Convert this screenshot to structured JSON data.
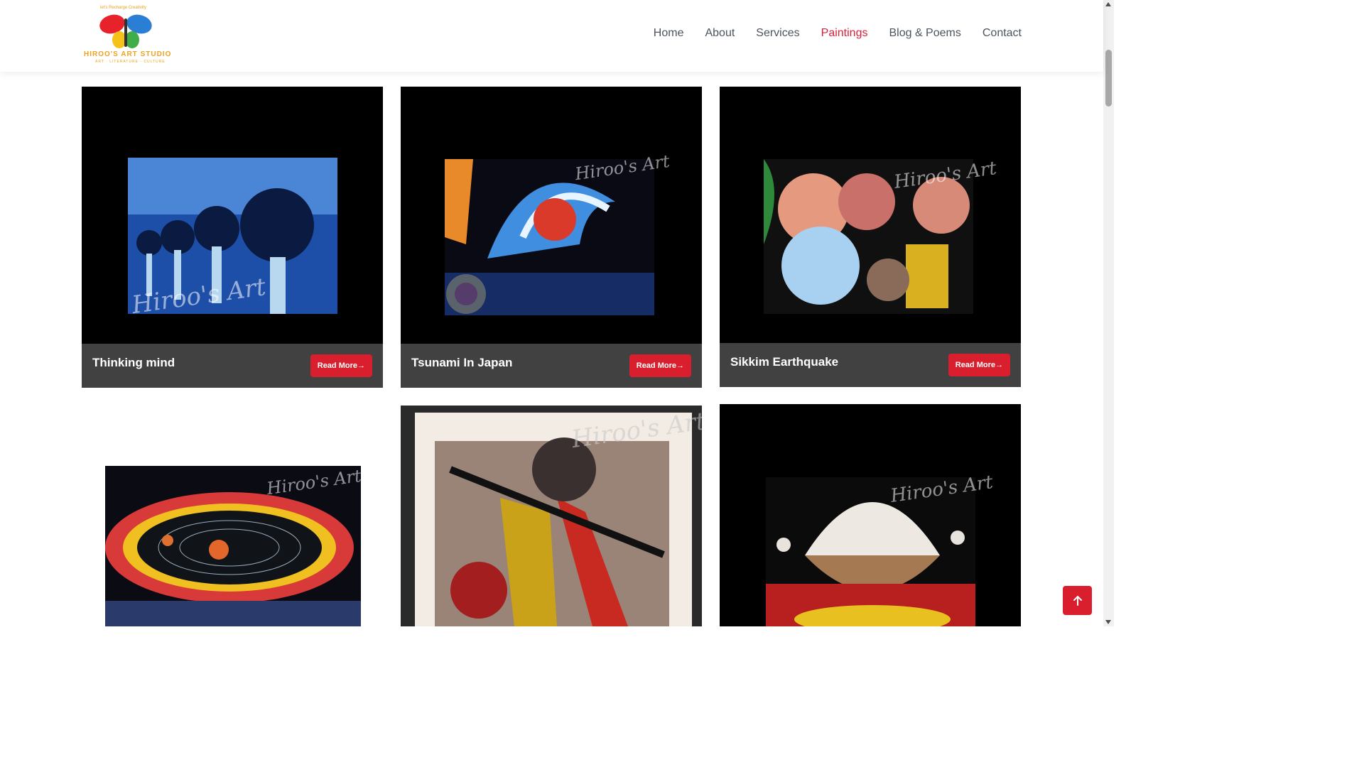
{
  "brand": {
    "tagline": "let's Recharge Creativity",
    "name": "HIROO'S ART STUDIO",
    "subline": "ART · LITERATURE · CULTURE"
  },
  "nav": {
    "items": [
      "Home",
      "About",
      "Services",
      "Paintings",
      "Blog & Poems",
      "Contact"
    ],
    "active": "Paintings"
  },
  "paintings": [
    {
      "title": "Thinking mind",
      "button": "Read More→",
      "watermark": "Hiroo's Art"
    },
    {
      "title": "Tsunami In Japan",
      "button": "Read More→",
      "watermark": "Hiroo's Art"
    },
    {
      "title": "Sikkim Earthquake",
      "button": "Read More→",
      "watermark": "Hiroo's Art"
    },
    {
      "watermark": "Hiroo's Art"
    },
    {
      "watermark": "Hiroo's Art"
    },
    {
      "watermark": "Hiroo's Art"
    }
  ],
  "colors": {
    "accent": "#d91f2e",
    "nav_text": "#4a5560",
    "caption_bg": "#464646"
  },
  "icons": {
    "back_to_top": "arrow-up-icon"
  }
}
